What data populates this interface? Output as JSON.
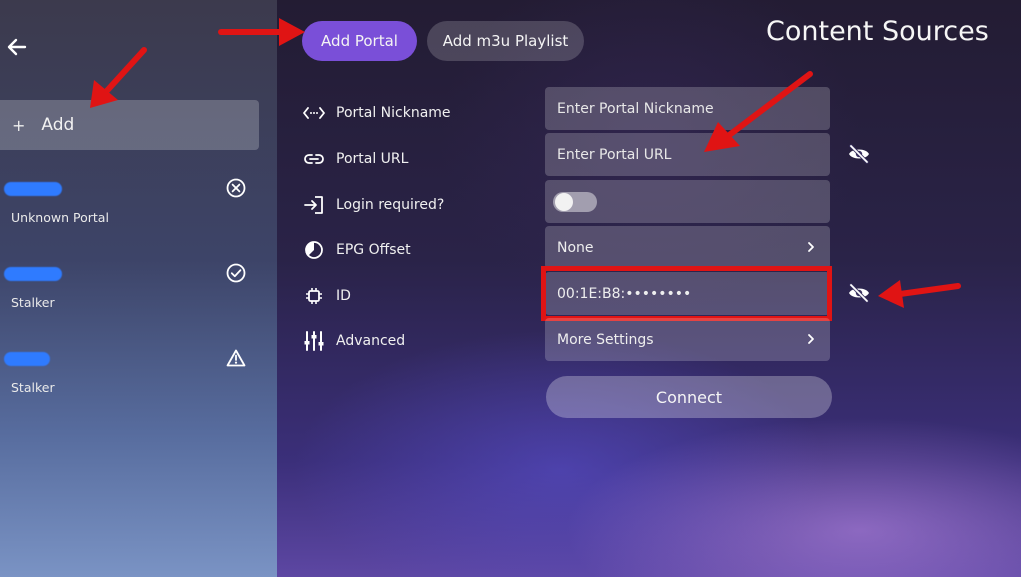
{
  "header": {
    "title": "Content Sources",
    "tabs": [
      {
        "label": "Add Portal",
        "active": true
      },
      {
        "label": "Add m3u Playlist",
        "active": false
      }
    ]
  },
  "sidebar": {
    "add_plus": "+",
    "add_label": "Add",
    "portals": [
      {
        "name": "Unknown Portal",
        "status_icon": "close-circle-icon"
      },
      {
        "name": "Stalker",
        "status_icon": "check-circle-icon"
      },
      {
        "name": "Stalker",
        "status_icon": "warning-icon"
      }
    ]
  },
  "form": {
    "nickname": {
      "label": "Portal Nickname",
      "placeholder": "Enter Portal Nickname",
      "icon": "code-icon"
    },
    "url": {
      "label": "Portal URL",
      "placeholder": "Enter Portal URL",
      "icon": "link-icon"
    },
    "login": {
      "label": "Login required?",
      "icon": "login-icon",
      "enabled": false
    },
    "epg": {
      "label": "EPG Offset",
      "value": "None",
      "icon": "clock-icon"
    },
    "id": {
      "label": "ID",
      "value": "00:1E:B8:••••••••",
      "icon": "chip-icon"
    },
    "advanced": {
      "label": "Advanced",
      "value": "More Settings",
      "icon": "sliders-icon"
    }
  },
  "connect_label": "Connect",
  "colors": {
    "accent": "#7a4fd8",
    "annotation_red": "#e01414"
  }
}
